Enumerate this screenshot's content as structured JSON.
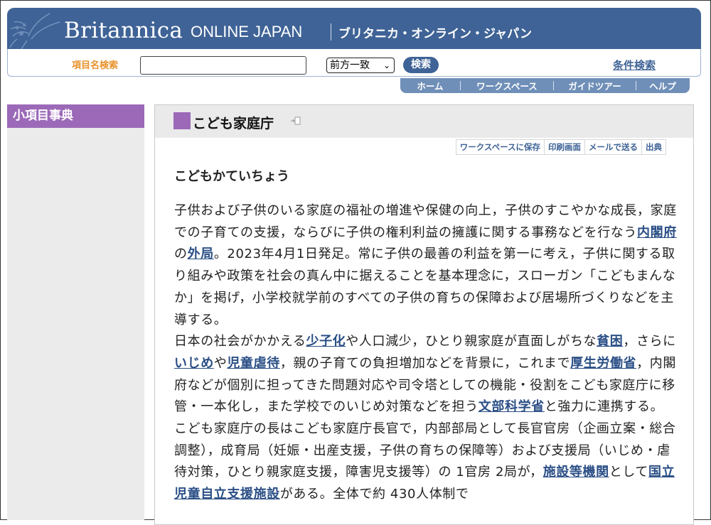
{
  "header": {
    "brand": "Britannica",
    "brand_sub": "ONLINE JAPAN",
    "brand_jp": "ブリタニカ・オンライン・ジャパン"
  },
  "search": {
    "label": "項目名検索",
    "input_value": "",
    "match_mode": "前方一致",
    "button": "検索",
    "advanced_link": "条件検索"
  },
  "nav": [
    "ホーム",
    "ワークスペース",
    "ガイドツアー",
    "ヘルプ"
  ],
  "sidebar": {
    "title": "小項目事典"
  },
  "article": {
    "title": "こども家庭庁",
    "reading": "こどもかていちょう",
    "actions": [
      "ワークスペースに保存",
      "印刷画面",
      "メールで送る",
      "出典"
    ],
    "paragraphs": [
      [
        {
          "t": "子供および子供のいる家庭の福祉の増進や保健の向上，子供のすこやかな成長，家庭での子育ての支援，ならびに子供の権利利益の擁護に関する事務などを行なう"
        },
        {
          "t": "内閣府",
          "link": true
        },
        {
          "t": "の"
        },
        {
          "t": "外局",
          "link": true
        },
        {
          "t": "。2023年4月1日発足。常に子供の最善の利益を第一に考え，子供に関する取り組みや政策を社会の真ん中に据えることを基本理念に，スローガン「こどもまんなか」を掲げ，小学校就学前のすべての子供の育ちの保障および居場所づくりなどを主導する。"
        }
      ],
      [
        {
          "t": "日本の社会がかかえる"
        },
        {
          "t": "少子化",
          "link": true
        },
        {
          "t": "や人口減少，ひとり親家庭が直面しがちな"
        },
        {
          "t": "貧困",
          "link": true
        },
        {
          "t": "，さらに"
        },
        {
          "t": "いじめ",
          "link": true
        },
        {
          "t": "や"
        },
        {
          "t": "児童虐待",
          "link": true
        },
        {
          "t": "，親の子育ての負担増加などを背景に，これまで"
        },
        {
          "t": "厚生労働省",
          "link": true
        },
        {
          "t": "，内閣府などが個別に担ってきた問題対応や司令塔としての機能・役割をこども家庭庁に移管・一本化し，また学校でのいじめ対策などを担う"
        },
        {
          "t": "文部科学省",
          "link": true
        },
        {
          "t": "と強力に連携する。"
        }
      ],
      [
        {
          "t": "こども家庭庁の長はこども家庭庁長官で，内部部局として長官官房（企画立案・総合調整），成育局（妊娠・出産支援，子供の育ちの保障等）および支援局（いじめ・虐待対策，ひとり親家庭支援，障害児支援等）の 1官房 2局が，"
        },
        {
          "t": "施設等機関",
          "link": true
        },
        {
          "t": "として"
        },
        {
          "t": "国立児童自立支援施設",
          "link": true
        },
        {
          "t": "がある。全体で約 430人体制で"
        }
      ]
    ]
  },
  "colors": {
    "brand_blue": "#3f6396",
    "nav_blue": "#6f8fb8",
    "purple": "#9c69b8",
    "orange_label": "#e8922c",
    "link": "#2b4f86"
  }
}
